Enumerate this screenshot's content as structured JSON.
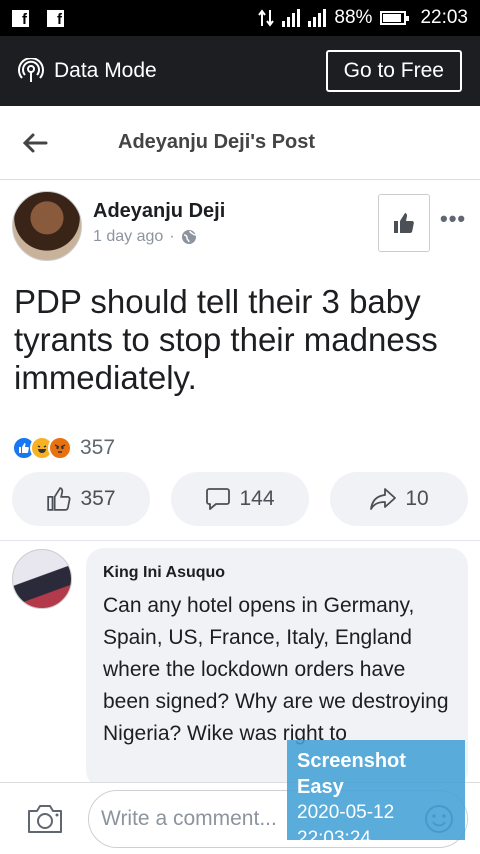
{
  "status_bar": {
    "time": "22:03",
    "battery": "88%",
    "signal_labels": [
      "H",
      "H"
    ]
  },
  "data_mode_bar": {
    "label": "Data Mode",
    "go_free": "Go to Free"
  },
  "header": {
    "title": "Adeyanju Deji's Post"
  },
  "post": {
    "author": "Adeyanju Deji",
    "time": "1 day ago",
    "separator": "·",
    "text": "PDP should tell their 3 baby tyrants to stop their madness immediately.",
    "reaction_count": "357",
    "actions": {
      "like": "357",
      "comment": "144",
      "share": "10"
    }
  },
  "comment": {
    "author": "King Ini Asuquo",
    "text": "Can any hotel opens in Germany, Spain, US, France, Italy, England where the lockdown orders have been signed? Why are we destroying Nigeria? Wike was right to"
  },
  "composer": {
    "placeholder": "Write a comment..."
  },
  "watermark": {
    "title": "Screenshot Easy",
    "date": "2020-05-12",
    "time": "22:03:24"
  },
  "colors": {
    "status_bar": "#000000",
    "data_bar": "#1c1e21",
    "pill_bg": "#f0f2f5",
    "like_blue": "#1877f2",
    "watermark": "#43a0d6"
  },
  "icons": [
    "facebook-icon",
    "data-transfer-icon",
    "signal-icon",
    "battery-icon",
    "wifi-broadcast-icon",
    "back-arrow-icon",
    "globe-icon",
    "thumbs-up-icon",
    "more-icon",
    "comment-icon",
    "share-icon",
    "camera-icon",
    "emoji-icon"
  ]
}
